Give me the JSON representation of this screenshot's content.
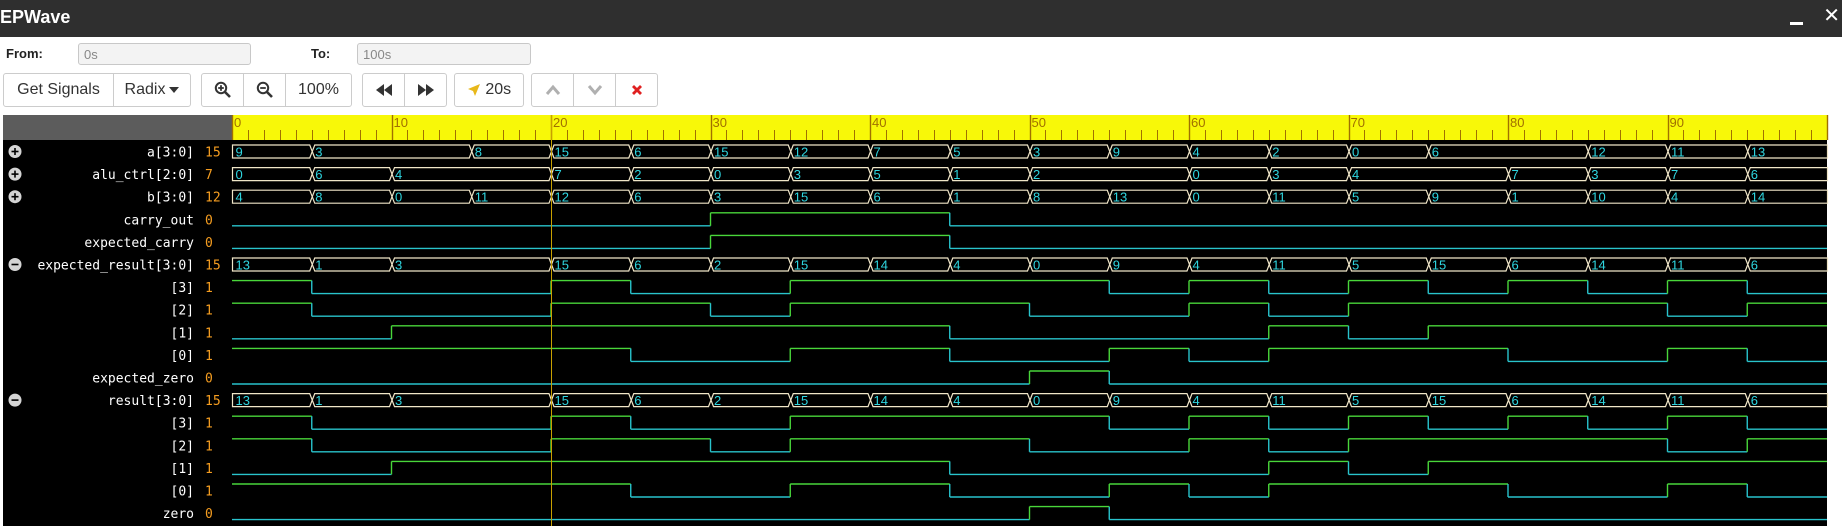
{
  "app": {
    "title": "EPWave"
  },
  "range": {
    "from_label": "From:",
    "from_value": "0s",
    "to_label": "To:",
    "to_value": "100s"
  },
  "toolbar": {
    "get_signals": "Get Signals",
    "radix": "Radix",
    "zoom_level": "100%",
    "cursor_time": "20s"
  },
  "icons": {
    "zoom_in": "zoom-in-icon",
    "zoom_out": "zoom-out-icon",
    "rewind": "rewind-icon",
    "fast_forward": "fast-forward-icon",
    "cursor": "location-arrow-icon",
    "up": "chevron-up-icon",
    "down": "chevron-down-icon",
    "delete": "delete-x-icon",
    "expand": "plus-circle-icon",
    "collapse": "minus-circle-icon"
  },
  "colors": {
    "title_bar": "#2f2f2f",
    "wave_bg": "#000000",
    "ruler_bg": "#f8f808",
    "ruler_text": "#a07000",
    "value": "#f59d20",
    "low_trace": "#29c3cc",
    "high_trace": "#49d63a",
    "bus_border": "#f0e6c8",
    "bus_text": "#2fd6e0",
    "cursor": "#c8a000",
    "delete": "#e02020"
  },
  "waveform": {
    "time_range": [
      0,
      100
    ],
    "cursor": 20,
    "ruler_ticks": [
      "0",
      "10",
      "20",
      "30",
      "40",
      "50",
      "60",
      "70",
      "80",
      "90"
    ],
    "signals": [
      {
        "name": "a[3:0]",
        "value": "15",
        "type": "bus",
        "toggle": "expand",
        "segments": [
          [
            0,
            "9"
          ],
          [
            5,
            "3"
          ],
          [
            15,
            "8"
          ],
          [
            20,
            "15"
          ],
          [
            25,
            "6"
          ],
          [
            30,
            "15"
          ],
          [
            35,
            "12"
          ],
          [
            40,
            "7"
          ],
          [
            45,
            "5"
          ],
          [
            50,
            "3"
          ],
          [
            55,
            "9"
          ],
          [
            60,
            "4"
          ],
          [
            65,
            "2"
          ],
          [
            70,
            "0"
          ],
          [
            75,
            "6"
          ],
          [
            85,
            "12"
          ],
          [
            90,
            "11"
          ],
          [
            95,
            "13"
          ]
        ]
      },
      {
        "name": "alu_ctrl[2:0]",
        "value": "7",
        "type": "bus",
        "toggle": "expand",
        "segments": [
          [
            0,
            "0"
          ],
          [
            5,
            "6"
          ],
          [
            10,
            "4"
          ],
          [
            20,
            "7"
          ],
          [
            25,
            "2"
          ],
          [
            30,
            "0"
          ],
          [
            35,
            "3"
          ],
          [
            40,
            "5"
          ],
          [
            45,
            "1"
          ],
          [
            50,
            "2"
          ],
          [
            60,
            "0"
          ],
          [
            65,
            "3"
          ],
          [
            70,
            "4"
          ],
          [
            80,
            "7"
          ],
          [
            85,
            "3"
          ],
          [
            90,
            "7"
          ],
          [
            95,
            "6"
          ]
        ]
      },
      {
        "name": "b[3:0]",
        "value": "12",
        "type": "bus",
        "toggle": "expand",
        "segments": [
          [
            0,
            "4"
          ],
          [
            5,
            "8"
          ],
          [
            10,
            "0"
          ],
          [
            15,
            "11"
          ],
          [
            20,
            "12"
          ],
          [
            25,
            "6"
          ],
          [
            30,
            "3"
          ],
          [
            35,
            "15"
          ],
          [
            40,
            "6"
          ],
          [
            45,
            "1"
          ],
          [
            50,
            "8"
          ],
          [
            55,
            "13"
          ],
          [
            60,
            "0"
          ],
          [
            65,
            "11"
          ],
          [
            70,
            "5"
          ],
          [
            75,
            "9"
          ],
          [
            80,
            "1"
          ],
          [
            85,
            "10"
          ],
          [
            90,
            "4"
          ],
          [
            95,
            "14"
          ]
        ]
      },
      {
        "name": "carry_out",
        "value": "0",
        "type": "bit",
        "changes": [
          [
            0,
            0
          ],
          [
            30,
            1
          ],
          [
            45,
            0
          ]
        ]
      },
      {
        "name": "expected_carry",
        "value": "0",
        "type": "bit",
        "changes": [
          [
            0,
            0
          ],
          [
            30,
            1
          ],
          [
            45,
            0
          ]
        ]
      },
      {
        "name": "expected_result[3:0]",
        "value": "15",
        "type": "bus",
        "toggle": "collapse",
        "segments": [
          [
            0,
            "13"
          ],
          [
            5,
            "1"
          ],
          [
            10,
            "3"
          ],
          [
            20,
            "15"
          ],
          [
            25,
            "6"
          ],
          [
            30,
            "2"
          ],
          [
            35,
            "15"
          ],
          [
            40,
            "14"
          ],
          [
            45,
            "4"
          ],
          [
            50,
            "0"
          ],
          [
            55,
            "9"
          ],
          [
            60,
            "4"
          ],
          [
            65,
            "11"
          ],
          [
            70,
            "5"
          ],
          [
            75,
            "15"
          ],
          [
            80,
            "6"
          ],
          [
            85,
            "14"
          ],
          [
            90,
            "11"
          ],
          [
            95,
            "6"
          ]
        ]
      },
      {
        "name": "[3]",
        "value": "1",
        "type": "bit",
        "changes": [
          [
            0,
            1
          ],
          [
            5,
            0
          ],
          [
            20,
            1
          ],
          [
            25,
            0
          ],
          [
            35,
            1
          ],
          [
            55,
            0
          ],
          [
            60,
            1
          ],
          [
            65,
            0
          ],
          [
            70,
            1
          ],
          [
            75,
            0
          ],
          [
            80,
            1
          ],
          [
            85,
            0
          ],
          [
            90,
            1
          ],
          [
            95,
            0
          ]
        ]
      },
      {
        "name": "[2]",
        "value": "1",
        "type": "bit",
        "changes": [
          [
            0,
            1
          ],
          [
            5,
            0
          ],
          [
            20,
            1
          ],
          [
            30,
            0
          ],
          [
            35,
            1
          ],
          [
            50,
            0
          ],
          [
            60,
            1
          ],
          [
            65,
            0
          ],
          [
            70,
            1
          ],
          [
            90,
            0
          ],
          [
            95,
            1
          ]
        ]
      },
      {
        "name": "[1]",
        "value": "1",
        "type": "bit",
        "changes": [
          [
            0,
            0
          ],
          [
            10,
            1
          ],
          [
            45,
            0
          ],
          [
            65,
            1
          ],
          [
            70,
            0
          ],
          [
            75,
            1
          ]
        ]
      },
      {
        "name": "[0]",
        "value": "1",
        "type": "bit",
        "changes": [
          [
            0,
            1
          ],
          [
            25,
            0
          ],
          [
            35,
            1
          ],
          [
            45,
            0
          ],
          [
            55,
            1
          ],
          [
            60,
            0
          ],
          [
            65,
            1
          ],
          [
            80,
            0
          ],
          [
            90,
            1
          ],
          [
            95,
            0
          ]
        ]
      },
      {
        "name": "expected_zero",
        "value": "0",
        "type": "bit",
        "changes": [
          [
            0,
            0
          ],
          [
            50,
            1
          ],
          [
            55,
            0
          ]
        ]
      },
      {
        "name": "result[3:0]",
        "value": "15",
        "type": "bus",
        "toggle": "collapse",
        "segments": [
          [
            0,
            "13"
          ],
          [
            5,
            "1"
          ],
          [
            10,
            "3"
          ],
          [
            20,
            "15"
          ],
          [
            25,
            "6"
          ],
          [
            30,
            "2"
          ],
          [
            35,
            "15"
          ],
          [
            40,
            "14"
          ],
          [
            45,
            "4"
          ],
          [
            50,
            "0"
          ],
          [
            55,
            "9"
          ],
          [
            60,
            "4"
          ],
          [
            65,
            "11"
          ],
          [
            70,
            "5"
          ],
          [
            75,
            "15"
          ],
          [
            80,
            "6"
          ],
          [
            85,
            "14"
          ],
          [
            90,
            "11"
          ],
          [
            95,
            "6"
          ]
        ]
      },
      {
        "name": "[3]",
        "value": "1",
        "type": "bit",
        "changes": [
          [
            0,
            1
          ],
          [
            5,
            0
          ],
          [
            20,
            1
          ],
          [
            25,
            0
          ],
          [
            35,
            1
          ],
          [
            55,
            0
          ],
          [
            60,
            1
          ],
          [
            65,
            0
          ],
          [
            70,
            1
          ],
          [
            75,
            0
          ],
          [
            80,
            1
          ],
          [
            85,
            0
          ],
          [
            90,
            1
          ],
          [
            95,
            0
          ]
        ]
      },
      {
        "name": "[2]",
        "value": "1",
        "type": "bit",
        "changes": [
          [
            0,
            1
          ],
          [
            5,
            0
          ],
          [
            20,
            1
          ],
          [
            30,
            0
          ],
          [
            35,
            1
          ],
          [
            50,
            0
          ],
          [
            60,
            1
          ],
          [
            65,
            0
          ],
          [
            70,
            1
          ],
          [
            90,
            0
          ],
          [
            95,
            1
          ]
        ]
      },
      {
        "name": "[1]",
        "value": "1",
        "type": "bit",
        "changes": [
          [
            0,
            0
          ],
          [
            10,
            1
          ],
          [
            45,
            0
          ],
          [
            65,
            1
          ],
          [
            70,
            0
          ],
          [
            75,
            1
          ]
        ]
      },
      {
        "name": "[0]",
        "value": "1",
        "type": "bit",
        "changes": [
          [
            0,
            1
          ],
          [
            25,
            0
          ],
          [
            35,
            1
          ],
          [
            45,
            0
          ],
          [
            55,
            1
          ],
          [
            60,
            0
          ],
          [
            65,
            1
          ],
          [
            80,
            0
          ],
          [
            90,
            1
          ],
          [
            95,
            0
          ]
        ]
      },
      {
        "name": "zero",
        "value": "0",
        "type": "bit",
        "changes": [
          [
            0,
            0
          ],
          [
            50,
            1
          ],
          [
            55,
            0
          ]
        ]
      }
    ]
  }
}
